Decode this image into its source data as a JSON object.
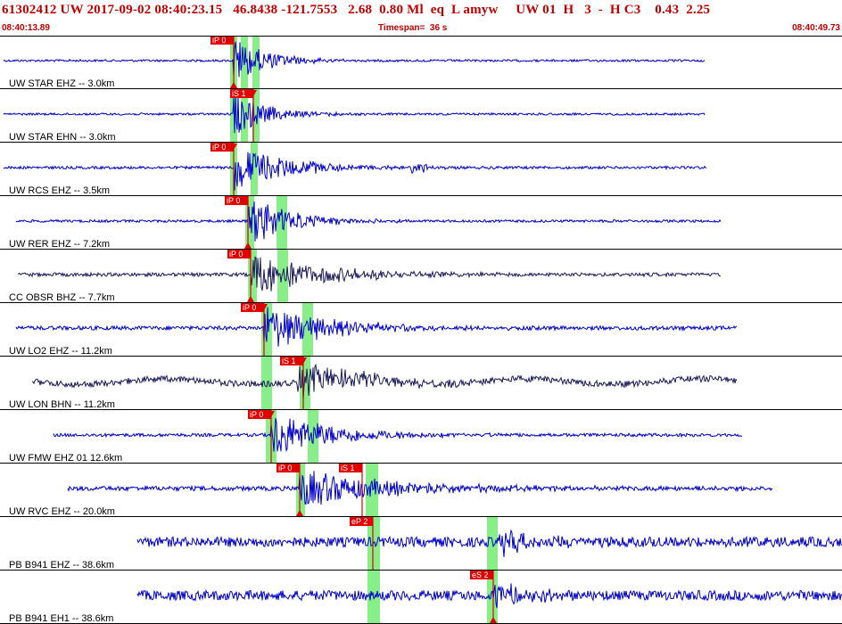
{
  "header": {
    "title": "61302412 UW 2017-09-02 08:40:23.15   46.8438 -121.7553   2.68  0.80 Ml  eq  L amyw     UW 01  H   3  -  H C3    0.43  2.25",
    "start_time": "08:40:13.89",
    "timespan": "Timespan=  36 s",
    "end_time": "08:40:49.73"
  },
  "colors": {
    "trace_blue": "#0000cc",
    "trace_dark": "#1a1a5a",
    "pick_red": "#e00000",
    "window_green": "#88ee88",
    "header_red": "#c00000",
    "separator": "#000000"
  },
  "traces": [
    {
      "label": "UW STAR EHZ -- 3.0km",
      "color": "trace_blue",
      "picks": [
        {
          "label": "iP 0",
          "kind": "P",
          "flag": "up"
        }
      ],
      "windows": 3
    },
    {
      "label": "UW STAR EHN -- 3.0km",
      "color": "trace_blue",
      "picks": [
        {
          "label": "iS 1",
          "kind": "S",
          "flag": "down"
        }
      ],
      "windows": 3
    },
    {
      "label": "UW RCS EHZ -- 3.5km",
      "color": "trace_blue",
      "picks": [
        {
          "label": "iP 0",
          "kind": "P",
          "flag": "down"
        }
      ],
      "windows": 2
    },
    {
      "label": "UW RER EHZ -- 7.2km",
      "color": "trace_blue",
      "picks": [
        {
          "label": "iP 0",
          "kind": "P",
          "flag": "up"
        }
      ],
      "windows": 2
    },
    {
      "label": "CC OBSR BHZ -- 7.7km",
      "color": "trace_dark",
      "picks": [
        {
          "label": "iP 0",
          "kind": "P",
          "flag": "up"
        }
      ],
      "windows": 2
    },
    {
      "label": "UW LO2 EHZ -- 11.2km",
      "color": "trace_blue",
      "picks": [
        {
          "label": "iP 0",
          "kind": "P",
          "flag": "down"
        }
      ],
      "windows": 2
    },
    {
      "label": "UW LON BHN -- 11.2km",
      "color": "trace_dark",
      "picks": [
        {
          "label": "iS 1",
          "kind": "S",
          "flag": "down"
        }
      ],
      "windows": 2
    },
    {
      "label": "UW FMW EHZ 01 12.6km",
      "color": "trace_blue",
      "picks": [
        {
          "label": "iP 0",
          "kind": "P",
          "flag": "down"
        }
      ],
      "windows": 2
    },
    {
      "label": "UW RVC EHZ -- 20.0km",
      "color": "trace_blue",
      "picks": [
        {
          "label": "iP 0",
          "kind": "P",
          "flag": "up"
        },
        {
          "label": "iS 1",
          "kind": "S",
          "flag": "none"
        }
      ],
      "windows": 2
    },
    {
      "label": "PB B941 EHZ -- 38.6km",
      "color": "trace_blue",
      "picks": [
        {
          "label": "eP 2",
          "kind": "P",
          "flag": "none"
        }
      ],
      "windows": 2
    },
    {
      "label": "PB B941 EH1 -- 38.6km",
      "color": "trace_blue",
      "picks": [
        {
          "label": "eS 2",
          "kind": "S",
          "flag": "up"
        }
      ],
      "windows": 2
    }
  ]
}
